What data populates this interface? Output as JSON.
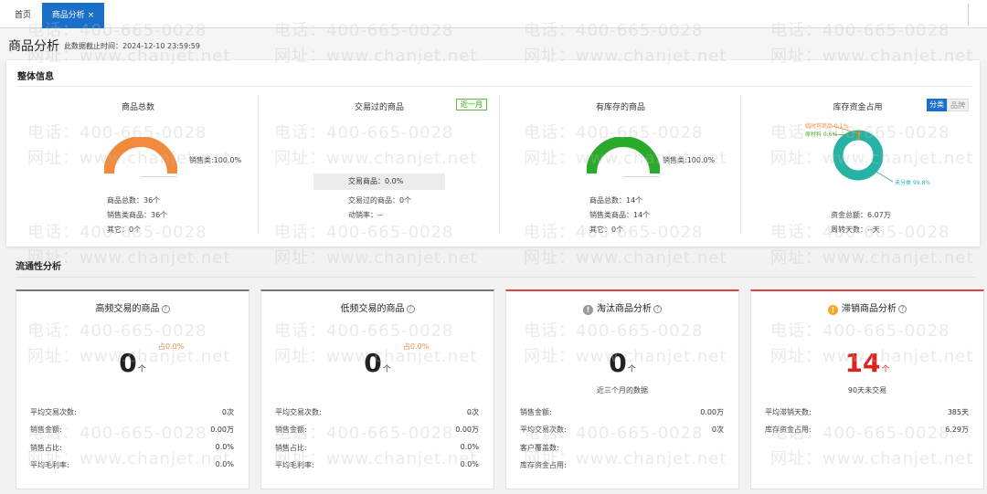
{
  "tabs": [
    {
      "label": "首页",
      "active": false
    },
    {
      "label": "商品分析",
      "active": true,
      "close": "×"
    }
  ],
  "header": {
    "title": "商品分析",
    "cutoff": "此数据截止时间：2024-12-10 23:59:59"
  },
  "overview": {
    "title": "整体信息",
    "total": {
      "title": "商品总数",
      "gauge_color": "#f28a3b",
      "gauge_label": "销售类:100.0%",
      "lines": [
        "商品总数：36个",
        "销售类商品：36个",
        "其它：0个"
      ]
    },
    "traded": {
      "title": "交易过的商品",
      "range": "近一月",
      "bar_text": "交易商品：0.0%",
      "lines": [
        "交易过的商品：0个",
        "动销率：--"
      ]
    },
    "stocked": {
      "title": "有库存的商品",
      "gauge_color": "#2aaa2a",
      "gauge_label": "销售类:100.0%",
      "lines": [
        "商品总数：14个",
        "销售类商品：14个",
        "其它：0个"
      ]
    },
    "capital": {
      "title": "库存资金占用",
      "toggle": [
        "分类",
        "品牌"
      ],
      "segments": [
        {
          "name": "未分类",
          "label": "未分类 99.8%",
          "percent": 99.8,
          "color": "#26b2a4"
        },
        {
          "name": "原材料",
          "label": "原材料 0.6%",
          "percent": 0.6,
          "color": "#5aa820"
        },
        {
          "name": "临时可商品",
          "label": "临时可商品 0.1%",
          "percent": 0.1,
          "color": "#f28a3b"
        }
      ],
      "lines": [
        "资金总额：6.07万",
        "周转天数：--天"
      ]
    }
  },
  "circulation": {
    "title": "流通性分析",
    "cards": [
      {
        "title": "高频交易的商品",
        "value": "0",
        "unit": "个",
        "pct": "占0.0%",
        "rows": [
          [
            "平均交易次数:",
            "0次"
          ],
          [
            "销售金额:",
            "0.00万"
          ],
          [
            "销售占比:",
            "0.0%"
          ],
          [
            "平均毛利率:",
            "0.0%"
          ]
        ]
      },
      {
        "title": "低频交易的商品",
        "value": "0",
        "unit": "个",
        "pct": "占0.0%",
        "rows": [
          [
            "平均交易次数:",
            "0次"
          ],
          [
            "销售金额:",
            "0.00万"
          ],
          [
            "销售占比:",
            "0.0%"
          ],
          [
            "平均毛利率:",
            "0.0%"
          ]
        ]
      },
      {
        "title": "淘汰商品分析",
        "icon": "!",
        "value": "0",
        "unit": "个",
        "sub": "近三个月的数据",
        "rows": [
          [
            "销售金额:",
            "0.00万"
          ],
          [
            "平均交易次数:",
            "0次"
          ],
          [
            "客户覆盖数:",
            ""
          ],
          [
            "库存资金占用:",
            ""
          ]
        ]
      },
      {
        "title": "滞销商品分析",
        "icon": "!",
        "value": "14",
        "unit": "个",
        "sub": "90天未交易",
        "rows": [
          [
            "平均滞销天数:",
            "385天"
          ],
          [
            "库存资金占用:",
            "6.29万"
          ]
        ]
      }
    ]
  },
  "watermark": {
    "phone": "电话：400-665-0028",
    "site": "网址：www.chanjet.net"
  }
}
